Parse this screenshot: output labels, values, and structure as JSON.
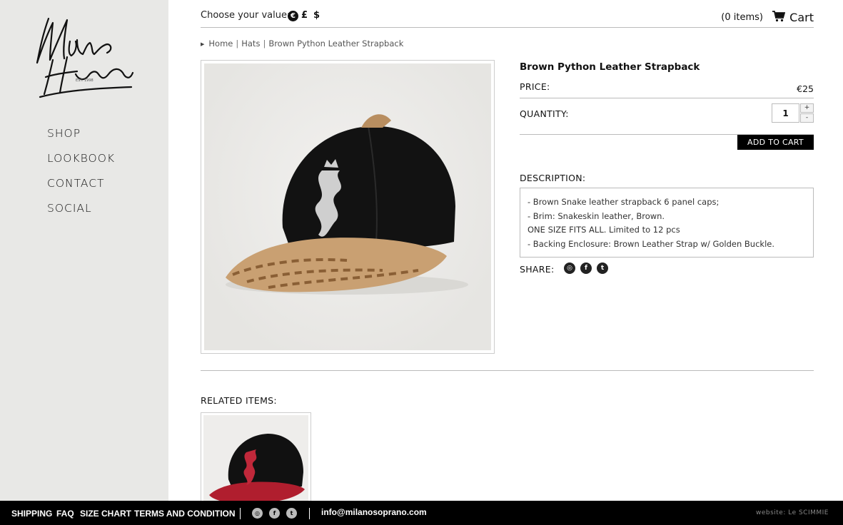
{
  "brand": {
    "logo_text_top": "Milano",
    "logo_text_bottom": "Hearted",
    "logo_est": "EST. 1998"
  },
  "sidebar": {
    "items": [
      {
        "label": "SHOP"
      },
      {
        "label": "LOOKBOOK"
      },
      {
        "label": "CONTACT"
      },
      {
        "label": "SOCIAL"
      }
    ]
  },
  "header": {
    "currency_label": "Choose your value:",
    "currencies": {
      "euro": "€",
      "pound": "£",
      "dollar": "$"
    },
    "cart_count": "(0 items)",
    "cart_label": "Cart"
  },
  "breadcrumb": {
    "home": "Home",
    "category": "Hats",
    "current": "Brown Python Leather Strapback"
  },
  "product": {
    "title": "Brown Python Leather Strapback",
    "price_label": "PRICE:",
    "price": "€25",
    "quantity_label": "QUANTITY:",
    "quantity": "1",
    "qty_plus": "+",
    "qty_minus": "-",
    "add_to_cart": "ADD TO CART",
    "description_label": "DESCRIPTION:",
    "description_lines": [
      "- Brown Snake leather strapback 6 panel caps;",
      "- Brim: Snakeskin leather, Brown.",
      "ONE SIZE FITS ALL. Limited to 12 pcs",
      "- Backing Enclosure: Brown Leather Strap w/ Golden Buckle."
    ],
    "share_label": "SHARE:"
  },
  "related": {
    "label": "RELATED ITEMS:"
  },
  "footer": {
    "links": {
      "shipping": "SHIPPING",
      "faq": "FAQ",
      "size_chart": "SIZE CHART",
      "terms": "TERMS AND CONDITION"
    },
    "email": "info@milanosoprano.com",
    "credit": "website: Le SCIMMIE"
  },
  "colors": {
    "sidebar_bg": "#e8e8e6",
    "footer_bg": "#000000",
    "accent": "#000000"
  },
  "icons": [
    "cart-icon",
    "instagram-icon",
    "facebook-icon",
    "tumblr-icon"
  ]
}
